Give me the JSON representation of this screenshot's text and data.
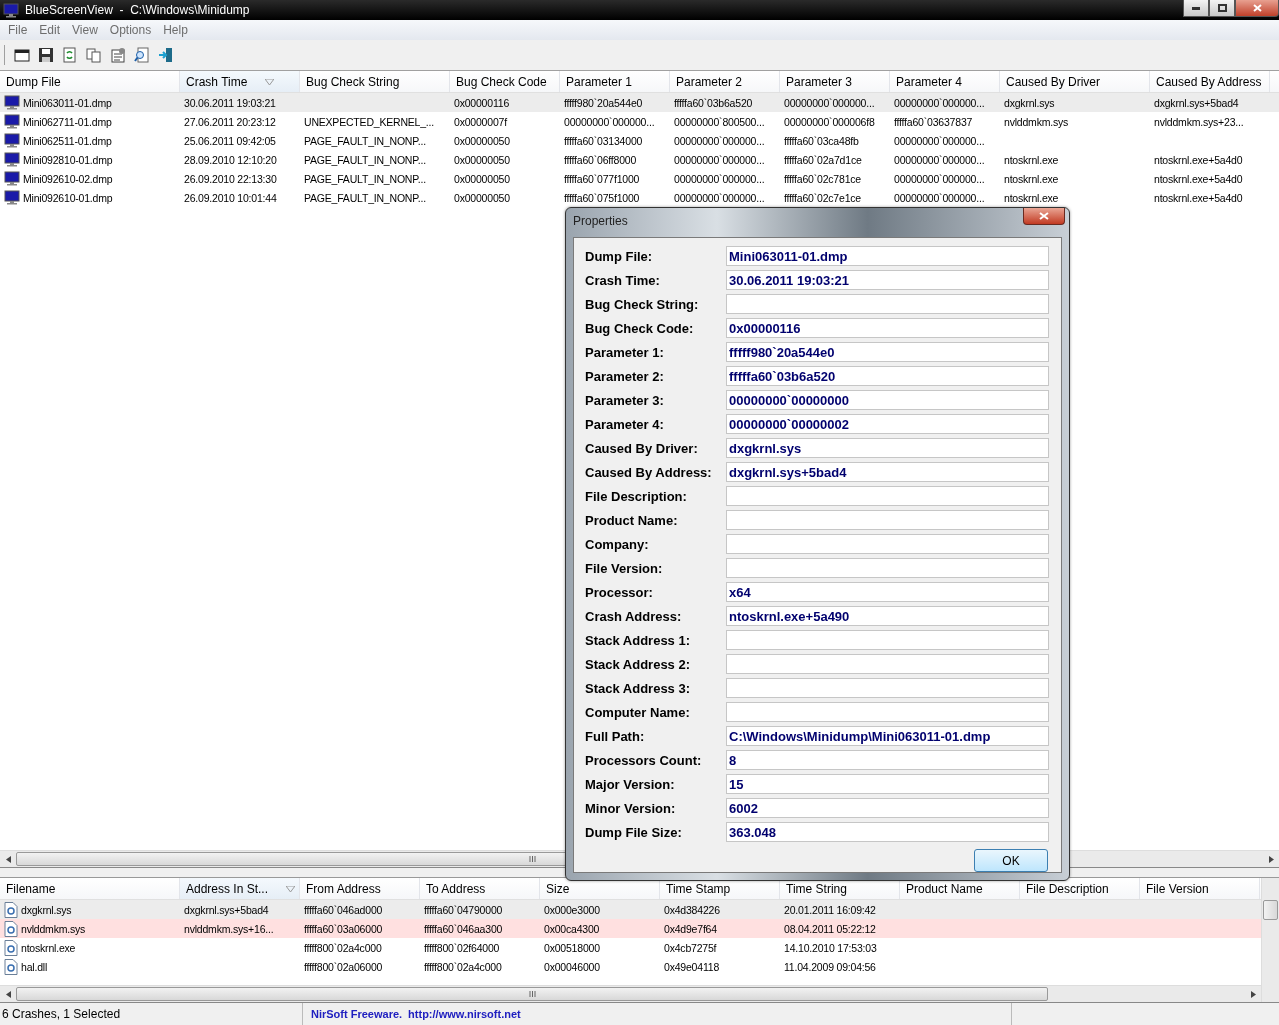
{
  "window": {
    "title": "BlueScreenView  -  C:\\Windows\\Minidump"
  },
  "menu": [
    "File",
    "Edit",
    "View",
    "Options",
    "Help"
  ],
  "crash_table": {
    "columns": [
      {
        "label": "Dump File",
        "sorted": false
      },
      {
        "label": "Crash Time",
        "sorted": true
      },
      {
        "label": "Bug Check String",
        "sorted": false
      },
      {
        "label": "Bug Check Code",
        "sorted": false
      },
      {
        "label": "Parameter 1",
        "sorted": false
      },
      {
        "label": "Parameter 2",
        "sorted": false
      },
      {
        "label": "Parameter 3",
        "sorted": false
      },
      {
        "label": "Parameter 4",
        "sorted": false
      },
      {
        "label": "Caused By Driver",
        "sorted": false
      },
      {
        "label": "Caused By Address",
        "sorted": false
      }
    ],
    "rows": [
      {
        "selected": true,
        "cells": [
          "Mini063011-01.dmp",
          "30.06.2011 19:03:21",
          null,
          "0x00000116",
          "fffff980`20a544e0",
          "fffffa60`03b6a520",
          "00000000`000000...",
          "00000000`000000...",
          "dxgkrnl.sys",
          "dxgkrnl.sys+5bad4"
        ]
      },
      {
        "selected": false,
        "cells": [
          "Mini062711-01.dmp",
          "27.06.2011 20:23:12",
          "UNEXPECTED_KERNEL_...",
          "0x0000007f",
          "00000000`000000...",
          "00000000`800500...",
          "00000000`000006f8",
          "fffffa60`03637837",
          "nvlddmkm.sys",
          "nvlddmkm.sys+23..."
        ]
      },
      {
        "selected": false,
        "cells": [
          "Mini062511-01.dmp",
          "25.06.2011 09:42:05",
          "PAGE_FAULT_IN_NONP...",
          "0x00000050",
          "fffffa60`03134000",
          "00000000`000000...",
          "fffffa60`03ca48fb",
          "00000000`000000..."
        ]
      },
      {
        "selected": false,
        "cells": [
          "Mini092810-01.dmp",
          "28.09.2010 12:10:20",
          "PAGE_FAULT_IN_NONP...",
          "0x00000050",
          "fffffa60`06ff8000",
          "00000000`000000...",
          "fffffa60`02a7d1ce",
          "00000000`000000...",
          "ntoskrnl.exe",
          "ntoskrnl.exe+5a4d0"
        ]
      },
      {
        "selected": false,
        "cells": [
          "Mini092610-02.dmp",
          "26.09.2010 22:13:30",
          "PAGE_FAULT_IN_NONP...",
          "0x00000050",
          "fffffa60`077f1000",
          "00000000`000000...",
          "fffffa60`02c781ce",
          "00000000`000000...",
          "ntoskrnl.exe",
          "ntoskrnl.exe+5a4d0"
        ]
      },
      {
        "selected": false,
        "cells": [
          "Mini092610-01.dmp",
          "26.09.2010 10:01:44",
          "PAGE_FAULT_IN_NONP...",
          "0x00000050",
          "fffffa60`075f1000",
          "00000000`000000...",
          "fffffa60`02c7e1ce",
          "00000000`000000...",
          "ntoskrnl.exe",
          "ntoskrnl.exe+5a4d0"
        ]
      }
    ]
  },
  "module_table": {
    "columns": [
      {
        "label": "Filename",
        "sorted": false
      },
      {
        "label": "Address In St...",
        "sorted": true
      },
      {
        "label": "From Address",
        "sorted": false
      },
      {
        "label": "To Address",
        "sorted": false
      },
      {
        "label": "Size",
        "sorted": false
      },
      {
        "label": "Time Stamp",
        "sorted": false
      },
      {
        "label": "Time String",
        "sorted": false
      },
      {
        "label": "Product Name",
        "sorted": false
      },
      {
        "label": "File Description",
        "sorted": false
      },
      {
        "label": "File Version",
        "sorted": false
      }
    ],
    "rows": [
      {
        "selected": true,
        "highlighted": false,
        "cells": [
          "dxgkrnl.sys",
          "dxgkrnl.sys+5bad4",
          "fffffa60`046ad000",
          "fffffa60`04790000",
          "0x000e3000",
          "0x4d384226",
          "20.01.2011 16:09:42"
        ]
      },
      {
        "selected": false,
        "highlighted": true,
        "cells": [
          "nvlddmkm.sys",
          "nvlddmkm.sys+16...",
          "fffffa60`03a06000",
          "fffffa60`046aa300",
          "0x00ca4300",
          "0x4d9e7f64",
          "08.04.2011 05:22:12"
        ]
      },
      {
        "selected": false,
        "highlighted": false,
        "cells": [
          "ntoskrnl.exe",
          null,
          "fffff800`02a4c000",
          "fffff800`02f64000",
          "0x00518000",
          "0x4cb7275f",
          "14.10.2010 17:53:03"
        ]
      },
      {
        "selected": false,
        "highlighted": false,
        "cells": [
          "hal.dll",
          null,
          "fffff800`02a06000",
          "fffff800`02a4c000",
          "0x00046000",
          "0x49e04118",
          "11.04.2009 09:04:56"
        ]
      }
    ]
  },
  "properties_dialog": {
    "title": "Properties",
    "fields": [
      {
        "label": "Dump File:",
        "value": "Mini063011-01.dmp"
      },
      {
        "label": "Crash Time:",
        "value": "30.06.2011 19:03:21"
      },
      {
        "label": "Bug Check String:"
      },
      {
        "label": "Bug Check Code:",
        "value": "0x00000116"
      },
      {
        "label": "Parameter 1:",
        "value": "fffff980`20a544e0"
      },
      {
        "label": "Parameter 2:",
        "value": "fffffa60`03b6a520"
      },
      {
        "label": "Parameter 3:",
        "value": "00000000`00000000"
      },
      {
        "label": "Parameter 4:",
        "value": "00000000`00000002"
      },
      {
        "label": "Caused By Driver:",
        "value": "dxgkrnl.sys"
      },
      {
        "label": "Caused By Address:",
        "value": "dxgkrnl.sys+5bad4"
      },
      {
        "label": "File Description:"
      },
      {
        "label": "Product Name:"
      },
      {
        "label": "Company:"
      },
      {
        "label": "File Version:"
      },
      {
        "label": "Processor:",
        "value": "x64"
      },
      {
        "label": "Crash Address:",
        "value": "ntoskrnl.exe+5a490"
      },
      {
        "label": "Stack Address 1:"
      },
      {
        "label": "Stack Address 2:"
      },
      {
        "label": "Stack Address 3:"
      },
      {
        "label": "Computer Name:"
      },
      {
        "label": "Full Path:",
        "value": "C:\\Windows\\Minidump\\Mini063011-01.dmp"
      },
      {
        "label": "Processors Count:",
        "value": "8"
      },
      {
        "label": "Major Version:",
        "value": "15"
      },
      {
        "label": "Minor Version:",
        "value": "6002"
      },
      {
        "label": "Dump File Size:",
        "value": "363.048"
      }
    ],
    "ok_button": "OK"
  },
  "status_bar": {
    "summary": "6 Crashes, 1 Selected",
    "credit": "NirSoft Freeware.",
    "link": "http://www.nirsoft.net"
  }
}
